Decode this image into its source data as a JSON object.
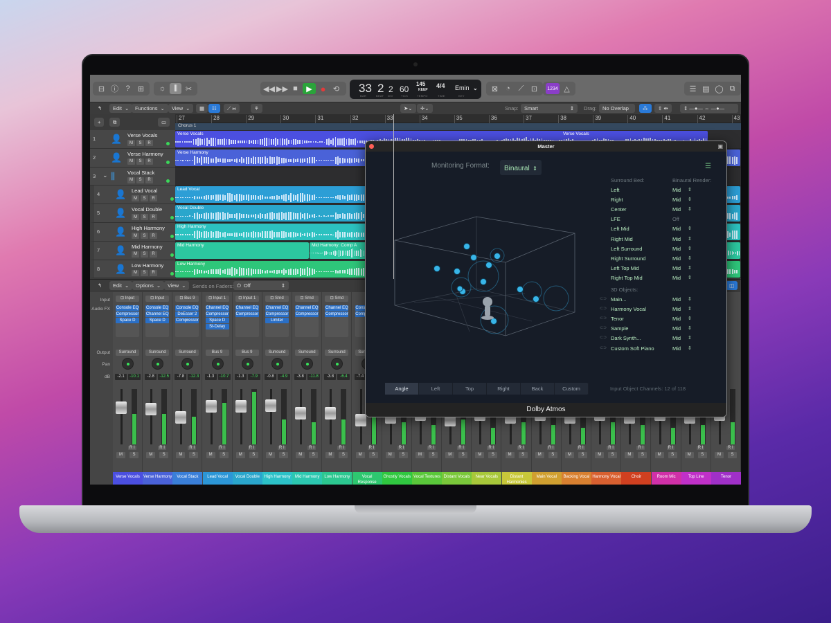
{
  "control_bar": {
    "left_icons": [
      "inbox-icon",
      "info-icon",
      "help-icon",
      "media-browser-icon"
    ],
    "view_icons": [
      "brightness-icon",
      "mixer-icon",
      "scissors-icon"
    ],
    "transport": [
      "rewind",
      "fast-forward",
      "stop",
      "play",
      "record",
      "cycle"
    ],
    "lcd": {
      "bar": "33",
      "beat": "2",
      "div": "2",
      "tick": "60",
      "tempo": "145",
      "tempo_mode": "KEEP",
      "time_sig": "4/4",
      "key": "Emin",
      "labels": {
        "bar": "BAR",
        "beat": "BEAT",
        "div": "DIV",
        "tick": "TICK",
        "tempo": "TEMPO",
        "time": "TIME",
        "key": "KEY"
      }
    },
    "count_in_badge": "1234",
    "colors": {
      "play": "#2aa43a",
      "record": "#e23b3b",
      "badge": "#8a3ec8"
    }
  },
  "tracks_toolbar": {
    "edit": "Edit",
    "functions": "Functions",
    "view": "View",
    "snap_label": "Snap:",
    "snap_value": "Smart",
    "drag_label": "Drag:",
    "drag_value": "No Overlap"
  },
  "ruler": {
    "bars": [
      "27",
      "28",
      "29",
      "30",
      "31",
      "32",
      "33",
      "34",
      "35",
      "36",
      "37",
      "38",
      "39",
      "40",
      "41",
      "42",
      "43"
    ],
    "marker": "Chorus 1"
  },
  "tracks": [
    {
      "num": "1",
      "name": "Verse Vocals",
      "color": "#4b4fe0",
      "icon_color": "#8a8cff",
      "regions": [
        {
          "name": "Verse Vocals",
          "start": 0,
          "end": 770
        },
        {
          "name": "Verse Vocals",
          "start": 770,
          "end": 770
        }
      ]
    },
    {
      "num": "2",
      "name": "Verse Harmony",
      "color": "#4a62d8",
      "icon_color": "#7d8ff0",
      "regions": [
        {
          "name": "Verse Harmony",
          "start": 0,
          "end": 817
        }
      ]
    },
    {
      "num": "3",
      "name": "Vocal Stack",
      "color": "#2a8fd8",
      "icon_color": "#3aa0f0",
      "regions": []
    },
    {
      "num": "4",
      "name": "Lead Vocal",
      "color": "#2c9ed6",
      "icon_color": "#3ab0f0",
      "regions": [
        {
          "name": "Lead Vocal",
          "start": 0,
          "end": 817
        }
      ]
    },
    {
      "num": "5",
      "name": "Vocal Double",
      "color": "#2aa6cc",
      "icon_color": "#3ab8e8",
      "regions": [
        {
          "name": "Vocal Double",
          "start": 0,
          "end": 817
        }
      ]
    },
    {
      "num": "6",
      "name": "High Harmony",
      "color": "#2cc2c0",
      "icon_color": "#36d0d0",
      "regions": [
        {
          "name": "High Harmony",
          "start": 0,
          "end": 817
        }
      ]
    },
    {
      "num": "7",
      "name": "Mid Harmony",
      "color": "#2cc8a0",
      "icon_color": "#36d8b0",
      "regions": [
        {
          "name": "Mid Harmony",
          "start": 0,
          "end": 194
        },
        {
          "name": "Mid Harmony: Comp A",
          "start": 194,
          "end": 817
        }
      ]
    },
    {
      "num": "8",
      "name": "Low Harmony",
      "color": "#2ec67a",
      "icon_color": "#3ad888",
      "regions": [
        {
          "name": "Low Harmony",
          "start": 0,
          "end": 817
        }
      ]
    }
  ],
  "track_buttons": {
    "mute": "M",
    "solo": "S",
    "record": "R"
  },
  "mixer_toolbar": {
    "edit": "Edit",
    "options": "Options",
    "view": "View",
    "sends_label": "Sends on Faders:",
    "sends_value": "Off"
  },
  "mixer_row_labels": {
    "input": "Input",
    "audio_fx": "Audio FX",
    "output": "Output",
    "pan": "Pan",
    "db": "dB"
  },
  "strip_buttons": {
    "r": "R",
    "i": "I",
    "m": "M",
    "s": "S"
  },
  "strips": [
    {
      "name": "Verse Vocals",
      "color": "#4b4fe0",
      "input": "Input",
      "fx": [
        "Console EQ",
        "Compressor",
        "Space D"
      ],
      "output": "Surround",
      "vol": "-2.1",
      "peak": "-10.1",
      "fader": 0.72,
      "level": 0.55
    },
    {
      "name": "Verse Harmony",
      "color": "#4a62d8",
      "input": "Input",
      "fx": [
        "Console EQ",
        "Channel EQ",
        "Space D"
      ],
      "output": "Surround",
      "vol": "-2.8",
      "peak": "-12.5",
      "fader": 0.7,
      "level": 0.55
    },
    {
      "name": "Vocal Stack",
      "color": "#3a7fd8",
      "input": "Bus 9",
      "fx": [
        "Console EQ",
        "DeEsser 2",
        "Compressor"
      ],
      "output": "Surround",
      "vol": "-7.8",
      "peak": "-12.3",
      "fader": 0.55,
      "level": 0.5
    },
    {
      "name": "Lead Vocal",
      "color": "#2c96d6",
      "input": "Input 1",
      "fx": [
        "Channel EQ",
        "Compressor",
        "Space D",
        "St-Delay"
      ],
      "output": "Bus 9",
      "vol": "-1.3",
      "peak": "-10.7",
      "fader": 0.75,
      "level": 0.75
    },
    {
      "name": "Vocal Double",
      "color": "#2aa6cc",
      "input": "Input 1",
      "fx": [
        "Channel EQ",
        "Compressor"
      ],
      "output": "Bus 9",
      "vol": "-1.3",
      "peak": "-7.9",
      "fader": 0.75,
      "level": 0.95
    },
    {
      "name": "High Harmony",
      "color": "#2cc2c8",
      "input": "Srnd",
      "fx": [
        "Channel EQ",
        "Compressor",
        "Limiter"
      ],
      "output": "Surround",
      "vol": "-0.8",
      "peak": "-4.9",
      "fader": 0.76,
      "level": 0.45
    },
    {
      "name": "Mid Harmony",
      "color": "#2cc8b0",
      "input": "Srnd",
      "fx": [
        "Channel EQ",
        "Compressor"
      ],
      "output": "Surround",
      "vol": "-3.8",
      "peak": "-11.8",
      "fader": 0.62,
      "level": 0.4
    },
    {
      "name": "Low Harmony",
      "color": "#2cc890",
      "input": "Srnd",
      "fx": [
        "Channel EQ",
        "Compressor"
      ],
      "output": "Surround",
      "vol": "-3.8",
      "peak": "-6.4",
      "fader": 0.62,
      "level": 0.45
    },
    {
      "name": "Vocal Response",
      "color": "#2ec870",
      "input": "",
      "fx": [
        "Console EQ",
        "Compressor"
      ],
      "output": "Surround",
      "vol": "-7.4",
      "peak": "",
      "fader": 0.5,
      "level": 0.5
    },
    {
      "name": "Ghostly Vocals",
      "color": "#30c840",
      "fader": 0.55,
      "level": 0.4
    },
    {
      "name": "Vocal Textures",
      "color": "#5ac83a",
      "fader": 0.6,
      "level": 0.35
    },
    {
      "name": "Distant Vocals",
      "color": "#7ac83a",
      "fader": 0.5,
      "level": 0.45
    },
    {
      "name": "Near Vocals",
      "color": "#a8c83a",
      "fader": 0.6,
      "level": 0.3
    },
    {
      "name": "Distant Harmonies",
      "color": "#c8c83a",
      "fader": 0.55,
      "level": 0.4
    },
    {
      "name": "Main Vocal",
      "color": "#d0a030",
      "fader": 0.6,
      "level": 0.35
    },
    {
      "name": "Backing Vocal",
      "color": "#d88030",
      "fader": 0.55,
      "level": 0.3
    },
    {
      "name": "Harmony Vocal",
      "color": "#d86030",
      "fader": 0.6,
      "level": 0.4
    },
    {
      "name": "Choir",
      "color": "#d04020",
      "fader": 0.55,
      "level": 0.35
    },
    {
      "name": "Room Mic",
      "color": "#d030a8",
      "fader": 0.6,
      "level": 0.3
    },
    {
      "name": "Top Line",
      "color": "#c030c8",
      "fader": 0.55,
      "level": 0.35
    },
    {
      "name": "Tenor",
      "color": "#a030c8",
      "fader": 0.6,
      "level": 0.4
    }
  ],
  "master_window": {
    "title": "Master",
    "monitoring_label": "Monitoring Format:",
    "monitoring_value": "Binaural",
    "surround_header": "Surround Bed:",
    "render_header": "Binaural Render:",
    "surround_bed": [
      {
        "name": "Left",
        "value": "Mid"
      },
      {
        "name": "Right",
        "value": "Mid"
      },
      {
        "name": "Center",
        "value": "Mid"
      },
      {
        "name": "LFE",
        "value": "Off"
      },
      {
        "name": "Left Mid",
        "value": "Mid"
      },
      {
        "name": "Right Mid",
        "value": "Mid"
      },
      {
        "name": "Left Surround",
        "value": "Mid"
      },
      {
        "name": "Right Surround",
        "value": "Mid"
      },
      {
        "name": "Left Top Mid",
        "value": "Mid"
      },
      {
        "name": "Right Top Mid",
        "value": "Mid"
      }
    ],
    "objects_header": "3D Objects:",
    "objects": [
      {
        "name": "Main...",
        "value": "Mid"
      },
      {
        "name": "Harmony Vocal",
        "value": "Mid"
      },
      {
        "name": "Tenor",
        "value": "Mid"
      },
      {
        "name": "Sample",
        "value": "Mid"
      },
      {
        "name": "Dark Synth...",
        "value": "Mid"
      },
      {
        "name": "Custom Soft Piano",
        "value": "Mid"
      }
    ],
    "view_tabs": [
      "Angle",
      "Left",
      "Top",
      "Right",
      "Back",
      "Custom"
    ],
    "active_tab": "Angle",
    "input_channels": "Input Object Channels: 12 of 118",
    "footer": "Dolby Atmos"
  }
}
